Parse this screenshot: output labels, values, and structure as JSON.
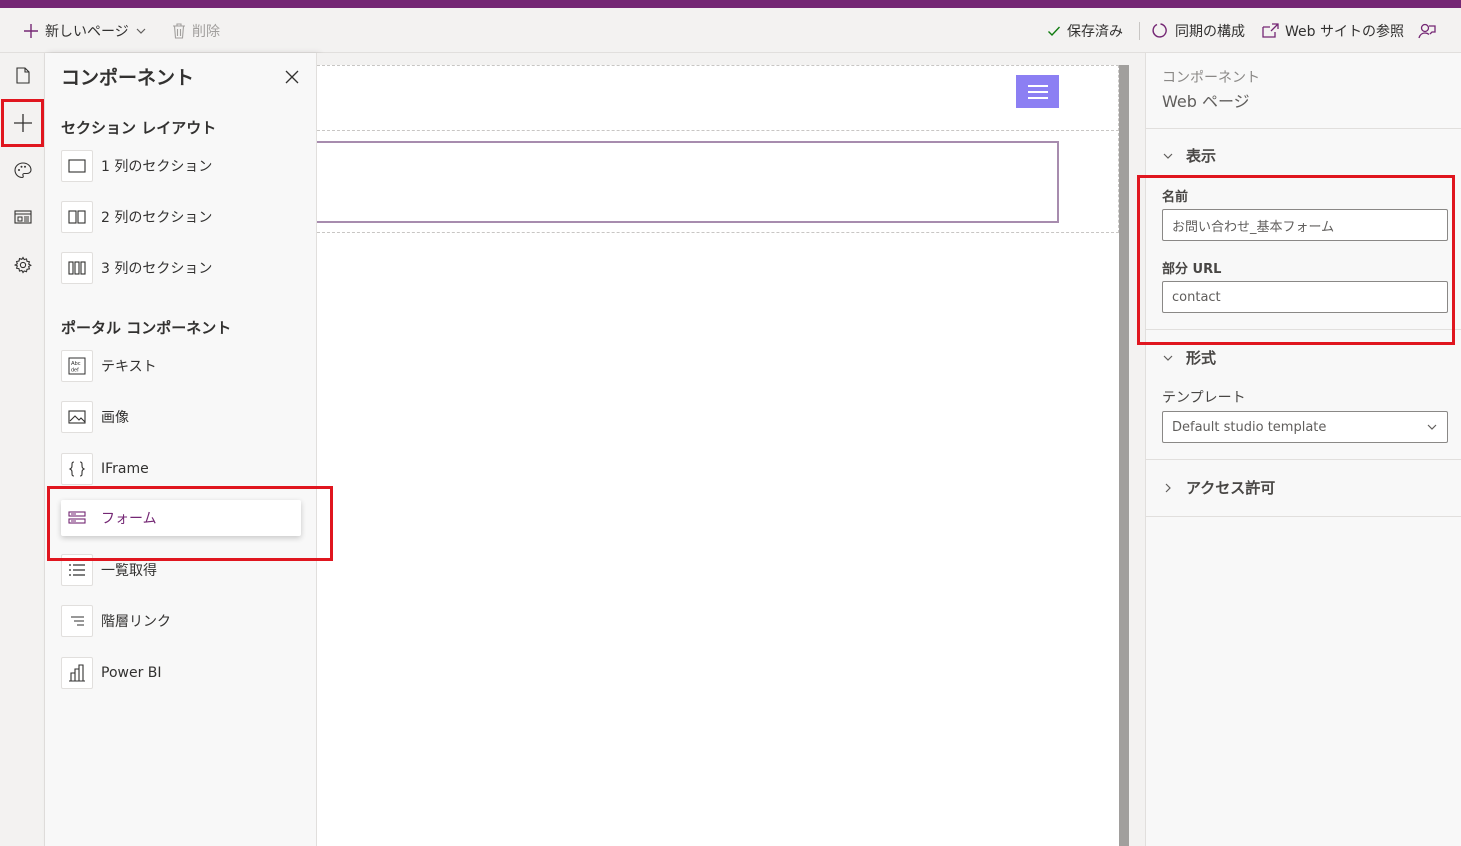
{
  "toolbar": {
    "new_page_label": "新しいページ",
    "delete_label": "削除",
    "saved_label": "保存済み",
    "sync_label": "同期の構成",
    "browse_label": "Web サイトの参照"
  },
  "components_panel": {
    "title": "コンポーネント",
    "section_layout_title": "セクション レイアウト",
    "layouts": [
      "1 列のセクション",
      "2 列のセクション",
      "3 列のセクション"
    ],
    "portal_title": "ポータル コンポーネント",
    "portal_items": [
      "テキスト",
      "画像",
      "IFrame",
      "フォーム",
      "一覧取得",
      "階層リンク",
      "Power BI"
    ],
    "active_item": "フォーム"
  },
  "properties": {
    "breadcrumb": "コンポーネント",
    "title": "Web ページ",
    "display_section": "表示",
    "name_label": "名前",
    "name_value": "お問い合わせ_基本フォーム",
    "partial_url_label": "部分 URL",
    "partial_url_value": "contact",
    "format_section": "形式",
    "template_label": "テンプレート",
    "template_value": "Default studio template",
    "access_section": "アクセス許可"
  },
  "colors": {
    "brand": "#742774",
    "highlight_box": "#e0161f",
    "menu_button": "#8c7ff3"
  }
}
